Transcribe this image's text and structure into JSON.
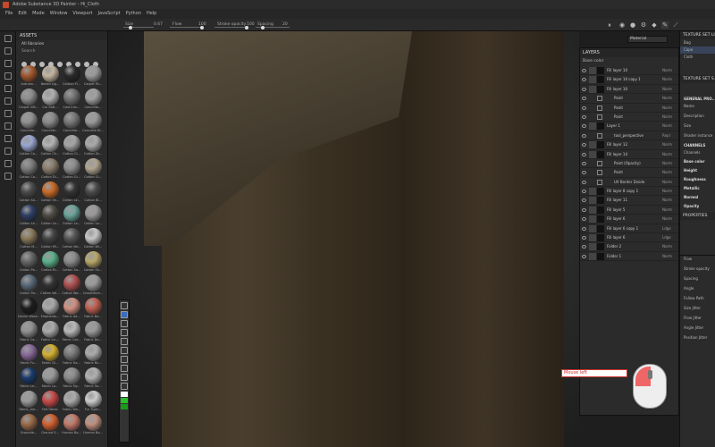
{
  "titlebar": {
    "title": "Adobe Substance 3D Painter - Hi_Cloth"
  },
  "menu": [
    "File",
    "Edit",
    "Mode",
    "Window",
    "Viewport",
    "JavaScript",
    "Python",
    "Help"
  ],
  "toolbar": {
    "size_label": "Size",
    "size_value": "0.67",
    "flow_label": "Flow",
    "flow_value": "100",
    "stroke_opacity_label": "Stroke opacity",
    "stroke_opacity_value": "100",
    "spacing_label": "Spacing",
    "spacing_value": "20"
  },
  "assets": {
    "title": "ASSETS",
    "library": "All libraries",
    "search_placeholder": "Search",
    "materials": [
      {
        "name": "Autumn...",
        "color": "#a3582e"
      },
      {
        "name": "Baked Lig...",
        "color": "#c3b6a0"
      },
      {
        "name": "Carbon Fi...",
        "color": "#2a2a2a"
      },
      {
        "name": "Carpet Mi...",
        "color": "#9a9a9a"
      },
      {
        "name": "Carpet ViB...",
        "color": "#8c8c8c"
      },
      {
        "name": "Car Soft...",
        "color": "#b0b0b0"
      },
      {
        "name": "Cast Iron...",
        "color": "#707070"
      },
      {
        "name": "Concrete...",
        "color": "#a0a0a0"
      },
      {
        "name": "Concrete...",
        "color": "#909090"
      },
      {
        "name": "Concrete...",
        "color": "#8a8a8a"
      },
      {
        "name": "Concrete...",
        "color": "#777"
      },
      {
        "name": "Concrete Bl...",
        "color": "#999"
      },
      {
        "name": "Cotton Ca...",
        "color": "#9aa6d0"
      },
      {
        "name": "Cotton Ch...",
        "color": "#b3b3b3"
      },
      {
        "name": "Cotton Cl...",
        "color": "#a5a5a5"
      },
      {
        "name": "Cotton Dr...",
        "color": "#aaa"
      },
      {
        "name": "Cotton Co...",
        "color": "#7c7c7c"
      },
      {
        "name": "Cotton Di...",
        "color": "#8b7d6b"
      },
      {
        "name": "Cotton Gi...",
        "color": "#8c8c8c"
      },
      {
        "name": "Cotton Gi...",
        "color": "#b0a48f"
      },
      {
        "name": "Cotton Sa...",
        "color": "#4a4a4a"
      },
      {
        "name": "Cotton Sh...",
        "color": "#c86a28"
      },
      {
        "name": "Cotton Le...",
        "color": "#333"
      },
      {
        "name": "Cotton Bl...",
        "color": "#4a4a4a"
      },
      {
        "name": "Cotton Le...",
        "color": "#2f3f66"
      },
      {
        "name": "Cotton Le...",
        "color": "#4f4b44"
      },
      {
        "name": "Cotton Le...",
        "color": "#6aa59a"
      },
      {
        "name": "Cotton Lo...",
        "color": "#999"
      },
      {
        "name": "Cotton M...",
        "color": "#8a7a5a"
      },
      {
        "name": "Cotton Mi...",
        "color": "#444"
      },
      {
        "name": "Cotton Ne...",
        "color": "#555"
      },
      {
        "name": "Cotton Wi...",
        "color": "#c7c7c7"
      },
      {
        "name": "Cotton Pa...",
        "color": "#666"
      },
      {
        "name": "Cotton Ri...",
        "color": "#5ab08a"
      },
      {
        "name": "Cotton Sa...",
        "color": "#8a8a8a"
      },
      {
        "name": "Cotton Sh...",
        "color": "#b8a76a"
      },
      {
        "name": "Cotton Tw...",
        "color": "#5a6a7a"
      },
      {
        "name": "Cotton Vel...",
        "color": "#333"
      },
      {
        "name": "Cotton Wa...",
        "color": "#b05050"
      },
      {
        "name": "Crosshatch...",
        "color": "#999"
      },
      {
        "name": "Denim Wash...",
        "color": "#1d1d1d"
      },
      {
        "name": "Elephants...",
        "color": "#aaa"
      },
      {
        "name": "Fabric Ad...",
        "color": "#d09080"
      },
      {
        "name": "Fabric Ba...",
        "color": "#c06050"
      },
      {
        "name": "Fabric Ca...",
        "color": "#909090"
      },
      {
        "name": "Fabric Lin...",
        "color": "#aaa"
      },
      {
        "name": "Fabric Cot...",
        "color": "#b8b8b8"
      },
      {
        "name": "Fabric De...",
        "color": "#999"
      },
      {
        "name": "Fabric Fu...",
        "color": "#8a6a9a"
      },
      {
        "name": "Fabric Gl...",
        "color": "#d4b030"
      },
      {
        "name": "Fabric Ha...",
        "color": "#7a7a7a"
      },
      {
        "name": "Fabric Kn...",
        "color": "#aaa"
      },
      {
        "name": "Fabric Le...",
        "color": "#1a3a6a"
      },
      {
        "name": "Fabric Lo...",
        "color": "#9a9a9a"
      },
      {
        "name": "Fabric Ny...",
        "color": "#8a8a8a"
      },
      {
        "name": "Fabric Sa...",
        "color": "#b0b0b0"
      },
      {
        "name": "Fabric_me...",
        "color": "#9a9a9a"
      },
      {
        "name": "Felt Fabric",
        "color": "#c84a4a"
      },
      {
        "name": "Fabric Wo...",
        "color": "#aaa"
      },
      {
        "name": "Fur Tiger...",
        "color": "#ccc"
      },
      {
        "name": "Groundb...",
        "color": "#9a6a4a"
      },
      {
        "name": "Ground S...",
        "color": "#d06030"
      },
      {
        "name": "Human Bo...",
        "color": "#c47a6a"
      },
      {
        "name": "Human Ba...",
        "color": "#c09080"
      }
    ]
  },
  "layers": {
    "title": "LAYERS",
    "channel": "Base color",
    "rows": [
      {
        "name": "Fill layer 10",
        "blend": "Norm",
        "sub": false
      },
      {
        "name": "Fill layer 10 copy 1",
        "blend": "Norm",
        "sub": false
      },
      {
        "name": "Fill layer 10",
        "blend": "Norm",
        "sub": false
      },
      {
        "name": "Paint",
        "blend": "Norm",
        "sub": true
      },
      {
        "name": "Paint",
        "blend": "Norm",
        "sub": true
      },
      {
        "name": "Paint",
        "blend": "Norm",
        "sub": true
      },
      {
        "name": "Layer 1",
        "blend": "Norm",
        "sub": false
      },
      {
        "name": "tool_perspective",
        "blend": "Repl",
        "sub": true
      },
      {
        "name": "Fill layer 12",
        "blend": "Norm",
        "sub": false
      },
      {
        "name": "Fill layer 14",
        "blend": "Norm",
        "sub": false
      },
      {
        "name": "Paint (Opacity)",
        "blend": "Norm",
        "sub": true
      },
      {
        "name": "Paint",
        "blend": "Norm",
        "sub": true
      },
      {
        "name": "UV Border Divide",
        "blend": "Norm",
        "sub": true
      },
      {
        "name": "Fill layer 8 copy 1",
        "blend": "Norm",
        "sub": false
      },
      {
        "name": "Fill layer 11",
        "blend": "Norm",
        "sub": false
      },
      {
        "name": "Fill layer 5",
        "blend": "Norm",
        "sub": false
      },
      {
        "name": "Fill layer 6",
        "blend": "Norm",
        "sub": false
      },
      {
        "name": "Fill layer 6 copy 1",
        "blend": "Ldge",
        "sub": false
      },
      {
        "name": "Fill layer 6",
        "blend": "Ldge",
        "sub": false
      },
      {
        "name": "Folder 2",
        "blend": "Norm",
        "sub": false
      },
      {
        "name": "Folder 1",
        "blend": "Norm",
        "sub": false
      }
    ]
  },
  "viewport": {
    "mode": "Material",
    "mouse_label": "Mouse left"
  },
  "texture_set_list": {
    "title": "TEXTURE SET LI...",
    "items": [
      "Bag",
      "Cape",
      "Cloth"
    ],
    "selected": 1
  },
  "texture_set_settings": {
    "title": "TEXTURE SET S...",
    "general": "GENERAL PRO...",
    "fields": [
      "Name",
      "Description",
      "Size",
      "Shader instance"
    ],
    "channels_title": "CHANNELS",
    "channels": [
      "Channels",
      "Base color",
      "Height",
      "Roughness",
      "Metallic",
      "Normal",
      "Opacity"
    ]
  },
  "properties": {
    "title": "PROPERTIES",
    "fields": [
      "Flow",
      "Stroke opacity",
      "Spacing",
      "Angle",
      "Follow Path",
      "Size Jitter",
      "Flow Jitter",
      "Angle Jitter",
      "Position Jitter"
    ]
  }
}
